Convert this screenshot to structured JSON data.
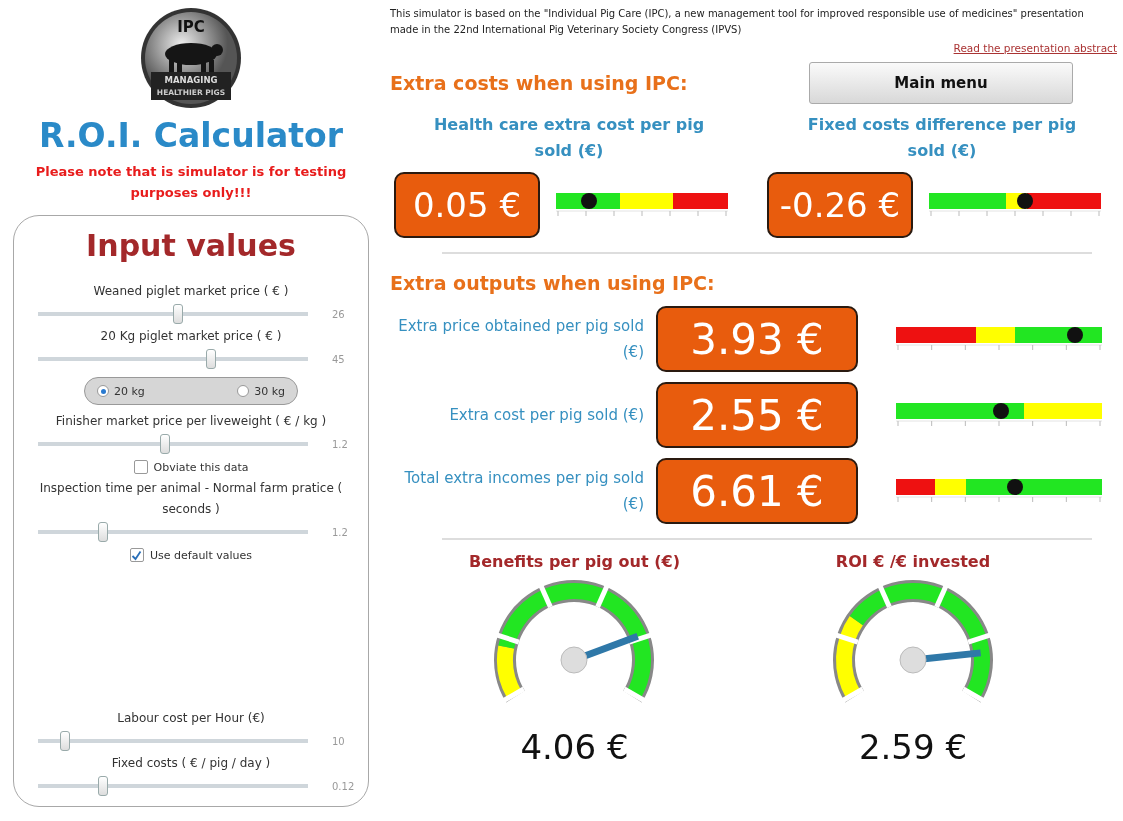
{
  "logo": {
    "top": "IPC",
    "band": "MANAGING",
    "bottom": "HEALTHIER PIGS"
  },
  "title": "R.O.I. Calculator",
  "note": "Please note that is simulator is for testing purposes only!!!",
  "input_panel": {
    "title": "Input values",
    "inputs": [
      {
        "kind": "slider",
        "label": "Weaned piglet market price ( € )",
        "value": "26",
        "level": 0.52
      },
      {
        "kind": "slider",
        "label": "20 Kg piglet market price ( € )",
        "value": "45",
        "level": 0.64
      },
      {
        "kind": "radio",
        "options": [
          {
            "label": "20 kg",
            "selected": true
          },
          {
            "label": "30 kg",
            "selected": false
          }
        ]
      },
      {
        "kind": "slider",
        "label": "Finisher market price per liveweight ( € / kg )",
        "value": "1.2",
        "level": 0.47
      },
      {
        "kind": "checkbox",
        "label": "Obviate this data",
        "checked": false
      },
      {
        "kind": "slider",
        "label": "Inspection time per animal - Normal farm pratice ( seconds )",
        "value": "1.2",
        "level": 0.24
      },
      {
        "kind": "checkbox",
        "label": "Use default values",
        "checked": true
      }
    ],
    "cost_inputs": [
      {
        "kind": "slider",
        "label": "Labour cost per Hour (€)",
        "value": "10",
        "level": 0.1
      },
      {
        "kind": "slider",
        "label": "Fixed costs ( € / pig / day )",
        "value": "0.12",
        "level": 0.24
      }
    ]
  },
  "intro": "This simulator is based on the \"Individual Pig Care (IPC), a new management tool for improved responsible use of medicines\" presentation made in the 22nd International Pig Veterinary Society Congress (IPVS)",
  "abstract_link": "Read the presentation abstract",
  "costs": {
    "heading": "Extra costs when using IPC:",
    "menu_button": "Main menu",
    "cards": [
      {
        "title": "Health care extra cost per pig sold (€)",
        "value": "0.05 €",
        "meter": {
          "level": 0.19,
          "segments": [
            {
              "color": "#22e622"
            },
            {
              "color": "#ffff00"
            },
            {
              "color": "#ee1111"
            }
          ]
        }
      },
      {
        "title": "Fixed costs difference per pig sold (€)",
        "value": "-0.26 €",
        "meter": {
          "level": 0.56,
          "segments": [
            {
              "color": "#22e622"
            },
            {
              "color": "#ffff00"
            },
            {
              "color": "#ee1111"
            }
          ]
        }
      }
    ]
  },
  "outputs": {
    "heading": "Extra outputs when using IPC:",
    "rows": [
      {
        "label": "Extra price obtained per pig sold (€)",
        "value": "3.93 €",
        "meter": {
          "level": 0.87,
          "segments": [
            {
              "color": "#ee1111"
            },
            {
              "color": "#ffff00"
            },
            {
              "color": "#22e622"
            }
          ]
        }
      },
      {
        "label": "Extra cost per pig sold (€)",
        "value": "2.55 €",
        "meter": {
          "level": 0.51,
          "segments": [
            {
              "color": "#22e622"
            },
            {
              "color": "#ffff00"
            }
          ]
        }
      },
      {
        "label": "Total extra incomes per pig sold (€)",
        "value": "6.61 €",
        "meter": {
          "level": 0.58,
          "segments": [
            {
              "color": "#ee1111"
            },
            {
              "color": "#ffff00"
            },
            {
              "color": "#22e622"
            }
          ]
        }
      }
    ]
  },
  "gauges": [
    {
      "title": "Benefits per pig out (€)",
      "value": "4.06 €",
      "bands": [
        {
          "color": "#ffff00"
        },
        {
          "color": "#22e622"
        }
      ]
    },
    {
      "title": "ROI € /€ invested",
      "value": "2.59 €",
      "bands": [
        {
          "color": "#ffff00"
        },
        {
          "color": "#22e622"
        }
      ]
    }
  ]
}
